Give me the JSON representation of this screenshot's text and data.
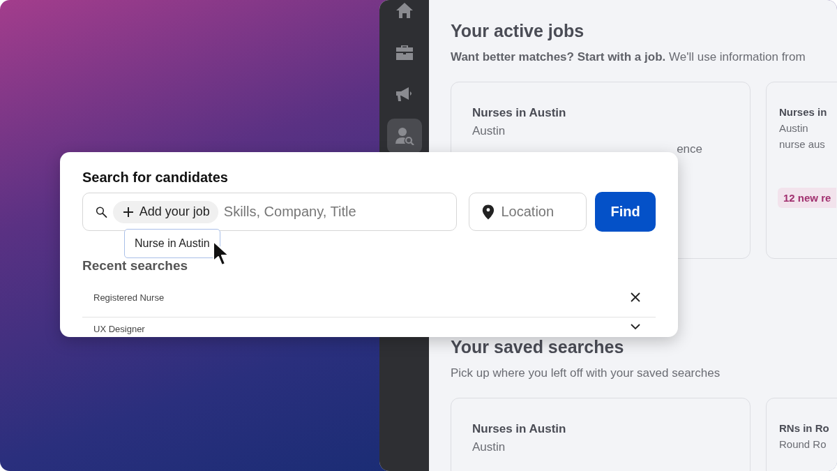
{
  "sidebar": {
    "items": [
      {
        "kind": "home",
        "selected": false
      },
      {
        "kind": "briefcase",
        "selected": false
      },
      {
        "kind": "megaphone",
        "selected": false
      },
      {
        "kind": "person-search",
        "selected": true
      }
    ]
  },
  "active_jobs": {
    "title": "Your active jobs",
    "subtitle": "**Want better matches? Start with a job.** We'll use information from",
    "cards": [
      {
        "title": "Nurses in Austin",
        "location": "Austin",
        "detail": "ence"
      },
      {
        "title": "Nurses in",
        "location": "Austin",
        "detail": "nurse aus",
        "badge": "12 new re"
      }
    ]
  },
  "saved_searches": {
    "title": "Your saved searches",
    "subtitle": "Pick up where you left off with your saved searches",
    "cards": [
      {
        "title": "Nurses in Austin",
        "location": "Austin"
      },
      {
        "title": "RNs in Ro",
        "location": "Round Ro"
      }
    ]
  },
  "search_dialog": {
    "title": "Search for candidates",
    "chip": "Add your job",
    "query_placeholder": "Skills, Company, Title",
    "location_placeholder": "Location",
    "find_button": "Find",
    "tooltip": "Nurse in Austin",
    "recent_title": "Recent searches",
    "recent": [
      {
        "label": "Registered Nurse",
        "kind": "remove"
      },
      {
        "label": "UX Designer",
        "kind": "expand"
      }
    ]
  }
}
